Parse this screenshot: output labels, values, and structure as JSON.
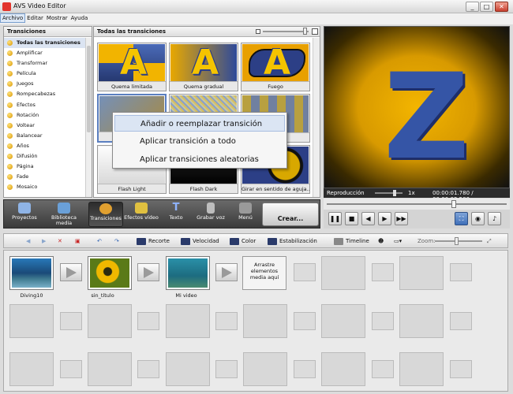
{
  "window": {
    "title": "AVS Video Editor",
    "buttons": [
      "_",
      "□",
      "✕"
    ]
  },
  "menu": [
    "Archivo",
    "Editar",
    "Mostrar",
    "Ayuda"
  ],
  "left_panel": {
    "title": "Transiciones",
    "items": [
      "Todas las transiciones",
      "Amplificar",
      "Transformar",
      "Película",
      "Juegos",
      "Rompecabezas",
      "Efectos",
      "Rotación",
      "Voltear",
      "Balancear",
      "Años",
      "Difusión",
      "Página",
      "Fade",
      "Mosaico"
    ]
  },
  "grid_panel": {
    "title": "Todas las transiciones",
    "thumbs": [
      "Quema limitada",
      "Quema gradual",
      "Fuego",
      "Des...",
      "",
      "",
      "Flash Light",
      "Flash Dark",
      "Girar en sentido de aguja..."
    ]
  },
  "context_menu": [
    "Añadir o reemplazar transición",
    "Aplicar transición a todo",
    "Aplicar transiciones aleatorias"
  ],
  "preview": {
    "letter": "Z",
    "label": "Reproducción",
    "speed": "1x",
    "time": "00:00:01.780 / 00:00:02.500"
  },
  "main_toolbar": [
    "Proyectos",
    "Biblioteca media",
    "Transiciones",
    "Efectos vídeo",
    "Texto",
    "Grabar voz",
    "Menú"
  ],
  "create_label": "Crear...",
  "timeline_toolbar": {
    "recorte": "Recorte",
    "velocidad": "Velocidad",
    "color": "Color",
    "estabilizacion": "Estabilización",
    "timeline": "Timeline",
    "zoom": "Zoom:"
  },
  "clips": [
    {
      "name": "Diving10"
    },
    {
      "name": "sin_título"
    },
    {
      "name": "Mi video"
    }
  ],
  "drop_text": "Arrastre elementos media aquí",
  "colors": {
    "accent": "#5b7fc0",
    "toolbar_dark": "#3a3a3a",
    "yellow": "#f5c400",
    "blue": "#3555a6"
  }
}
